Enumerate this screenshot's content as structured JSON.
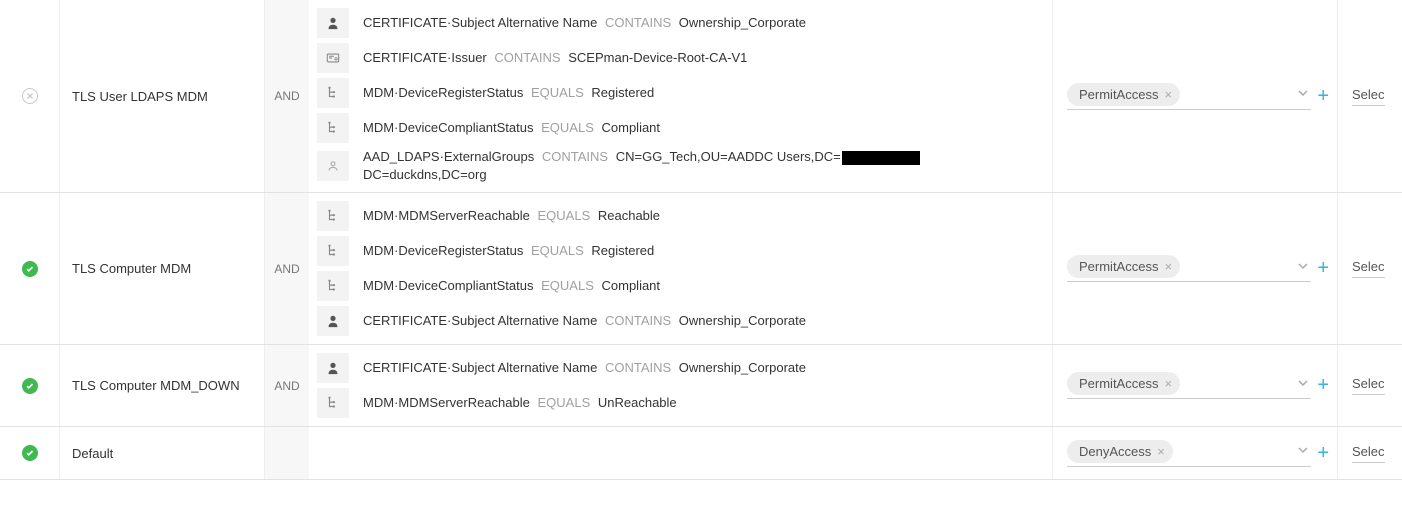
{
  "rows": [
    {
      "status": "none",
      "name": "TLS User LDAPS MDM",
      "logic": "AND",
      "result_chip": "PermitAccess",
      "extra": "Selec",
      "conditions": [
        {
          "icon": "user",
          "attr": "CERTIFICATE·Subject Alternative Name",
          "op": "CONTAINS",
          "val": "Ownership_Corporate"
        },
        {
          "icon": "cert",
          "attr": "CERTIFICATE·Issuer",
          "op": "CONTAINS",
          "val": "SCEPman-Device-Root-CA-V1"
        },
        {
          "icon": "tree",
          "attr": "MDM·DeviceRegisterStatus",
          "op": "EQUALS",
          "val": "Registered"
        },
        {
          "icon": "tree",
          "attr": "MDM·DeviceCompliantStatus",
          "op": "EQUALS",
          "val": "Compliant"
        },
        {
          "icon": "person",
          "attr": "AAD_LDAPS·ExternalGroups",
          "op": "CONTAINS",
          "val_pre": "CN=GG_Tech,OU=AADDC Users,DC=",
          "val_post": "DC=duckdns,DC=org",
          "redacted": true
        }
      ]
    },
    {
      "status": "ok",
      "name": "TLS Computer MDM",
      "logic": "AND",
      "result_chip": "PermitAccess",
      "extra": "Selec",
      "conditions": [
        {
          "icon": "tree",
          "attr": "MDM·MDMServerReachable",
          "op": "EQUALS",
          "val": "Reachable"
        },
        {
          "icon": "tree",
          "attr": "MDM·DeviceRegisterStatus",
          "op": "EQUALS",
          "val": "Registered"
        },
        {
          "icon": "tree",
          "attr": "MDM·DeviceCompliantStatus",
          "op": "EQUALS",
          "val": "Compliant"
        },
        {
          "icon": "user",
          "attr": "CERTIFICATE·Subject Alternative Name",
          "op": "CONTAINS",
          "val": "Ownership_Corporate"
        }
      ]
    },
    {
      "status": "ok",
      "name": "TLS Computer MDM_DOWN",
      "logic": "AND",
      "result_chip": "PermitAccess",
      "extra": "Selec",
      "conditions": [
        {
          "icon": "user",
          "attr": "CERTIFICATE·Subject Alternative Name",
          "op": "CONTAINS",
          "val": "Ownership_Corporate"
        },
        {
          "icon": "tree",
          "attr": "MDM·MDMServerReachable",
          "op": "EQUALS",
          "val": "UnReachable"
        }
      ]
    },
    {
      "status": "ok",
      "name": "Default",
      "logic": "",
      "result_chip": "DenyAccess",
      "extra": "Selec",
      "conditions": []
    }
  ]
}
